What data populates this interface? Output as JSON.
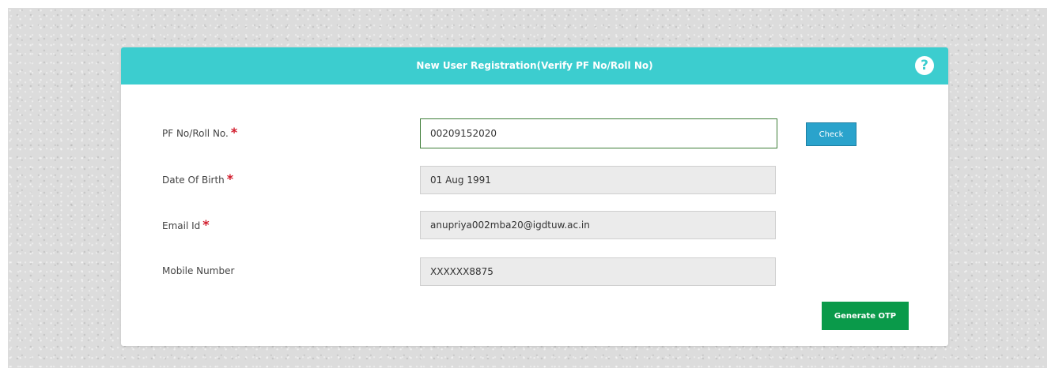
{
  "form": {
    "title": "New User Registration(Verify PF No/Roll No)",
    "help_icon": "?",
    "fields": [
      {
        "label": "PF No/Roll No.",
        "required_mark": "*",
        "value": "00209152020"
      },
      {
        "label": "Date Of Birth",
        "required_mark": "*",
        "value": "01 Aug 1991"
      },
      {
        "label": "Email Id",
        "required_mark": "*",
        "value": "anupriya002mba20@igdtuw.ac.in"
      },
      {
        "label": "Mobile Number",
        "value": "XXXXXX8875"
      }
    ],
    "check_label": "Check",
    "generate_otp_label": "Generate OTP"
  },
  "colors": {
    "header": "#3ccdcf",
    "check_button": "#2aa3cc",
    "otp_button": "#0a9a4a",
    "required": "#d11a2a",
    "active_border": "#3e7d37"
  },
  "icons": {
    "help": "question-circle-icon"
  }
}
